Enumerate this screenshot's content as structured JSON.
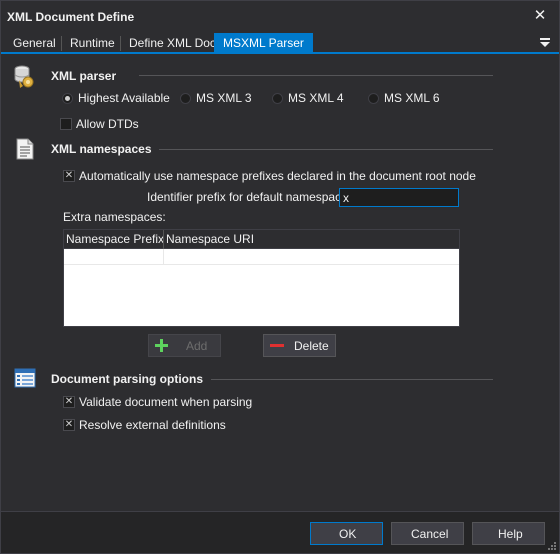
{
  "window": {
    "title": "XML Document Define"
  },
  "tabs": [
    {
      "label": "General"
    },
    {
      "label": "Runtime"
    },
    {
      "label": "Define XML Doc"
    },
    {
      "label": "MSXML Parser",
      "active": true
    }
  ],
  "xml_parser": {
    "title": "XML parser",
    "options": [
      {
        "label": "Highest Available",
        "selected": true
      },
      {
        "label": "MS XML 3",
        "selected": false
      },
      {
        "label": "MS XML 4",
        "selected": false
      },
      {
        "label": "MS XML 6",
        "selected": false
      }
    ],
    "allow_dtds": {
      "label": "Allow DTDs",
      "checked": false
    }
  },
  "xml_namespaces": {
    "title": "XML namespaces",
    "use_prefixes": {
      "label": "Automatically use namespace prefixes declared in the document root node",
      "checked": true
    },
    "identifier_prefix": {
      "label": "Identifier prefix for default namespace:",
      "value": "x"
    },
    "extra_label": "Extra namespaces:",
    "columns": [
      "Namespace Prefix",
      "Namespace URI"
    ],
    "add_label": "Add",
    "delete_label": "Delete"
  },
  "parsing_options": {
    "title": "Document parsing options",
    "validate": {
      "label": "Validate document when parsing",
      "checked": true
    },
    "resolve": {
      "label": "Resolve external definitions",
      "checked": true
    }
  },
  "footer": {
    "ok_label": "OK",
    "cancel_label": "Cancel",
    "help_label": "Help"
  },
  "icons": {
    "close": "close-icon",
    "tab_menu": "dropdown-menu-icon",
    "xml_parser": "database-gear-icon",
    "xml_namespaces": "document-icon",
    "parsing_options": "list-icon",
    "add": "plus-icon",
    "delete": "minus-icon"
  },
  "colors": {
    "accent": "#007acc",
    "background": "#2d2d30",
    "add_green": "#5ed25e",
    "delete_red": "#e03030"
  }
}
